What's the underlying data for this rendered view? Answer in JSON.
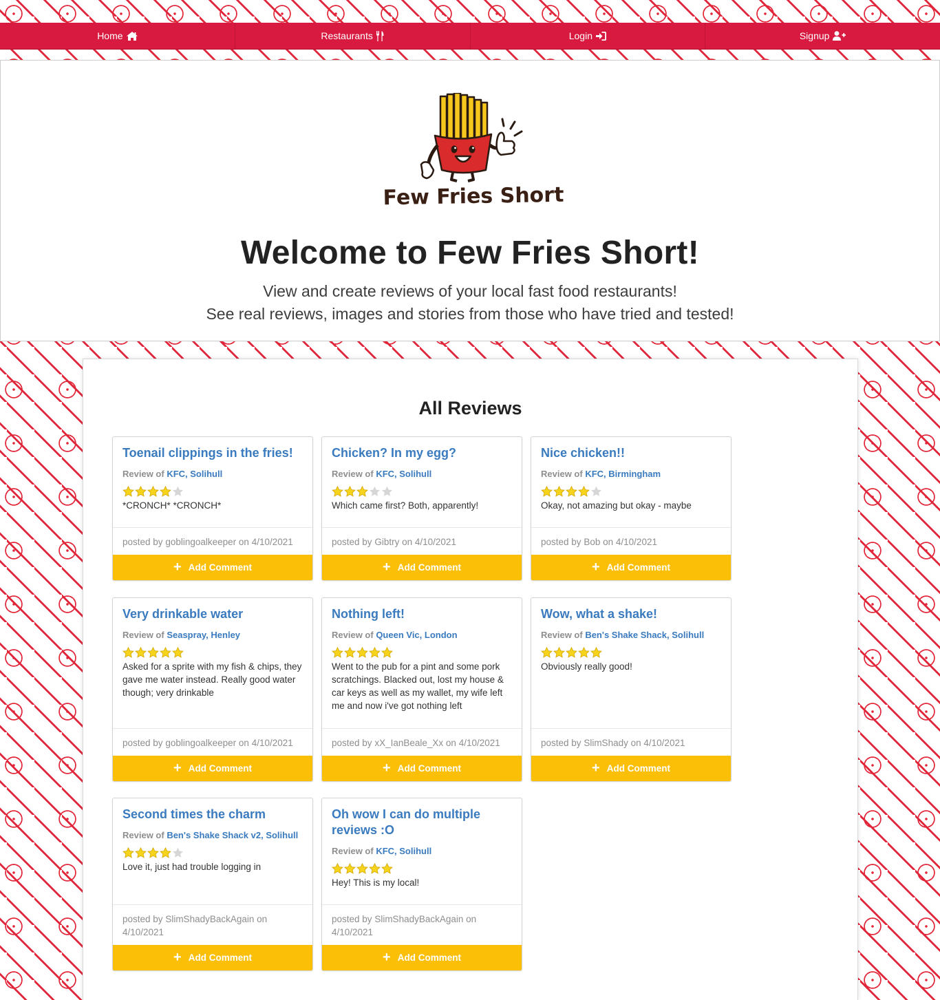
{
  "nav": {
    "items": [
      {
        "label": "Home",
        "icon": "home-icon"
      },
      {
        "label": "Restaurants",
        "icon": "utensils-icon"
      },
      {
        "label": "Login",
        "icon": "sign-in-icon"
      },
      {
        "label": "Signup",
        "icon": "user-plus-icon"
      }
    ]
  },
  "hero": {
    "logo_text": "Few Fries Short",
    "title": "Welcome to Few Fries Short!",
    "subtitle_line1": "View and create reviews of your local fast food restaurants!",
    "subtitle_line2": "See real reviews, images and stories from those who have tried and tested!"
  },
  "reviews_section": {
    "title": "All Reviews",
    "review_of_prefix": "Review of",
    "posted_by_prefix": "posted by",
    "posted_on_word": "on",
    "add_comment_label": "Add Comment",
    "cards": [
      {
        "title": "Toenail clippings in the fries!",
        "restaurant": "KFC, Solihull",
        "rating": 4,
        "text": "*CRONCH* *CRONCH*",
        "author": "goblingoalkeeper",
        "date": "4/10/2021"
      },
      {
        "title": "Chicken? In my egg?",
        "restaurant": "KFC, Solihull",
        "rating": 3,
        "text": "Which came first? Both, apparently!",
        "author": "Gibtry",
        "date": "4/10/2021"
      },
      {
        "title": "Nice chicken!!",
        "restaurant": "KFC, Birmingham",
        "rating": 4,
        "text": "Okay, not amazing but okay - maybe",
        "author": "Bob",
        "date": "4/10/2021"
      },
      {
        "title": "Very drinkable water",
        "restaurant": "Seaspray, Henley",
        "rating": 5,
        "text": "Asked for a sprite with my fish & chips, they gave me water instead. Really good water though; very drinkable",
        "author": "goblingoalkeeper",
        "date": "4/10/2021"
      },
      {
        "title": "Nothing left!",
        "restaurant": "Queen Vic, London",
        "rating": 5,
        "text": "Went to the pub for a pint and some pork scratchings. Blacked out, lost my house & car keys as well as my wallet, my wife left me and now i've got nothing left",
        "author": "xX_IanBeale_Xx",
        "date": "4/10/2021"
      },
      {
        "title": "Wow, what a shake!",
        "restaurant": "Ben's Shake Shack, Solihull",
        "rating": 5,
        "text": "Obviously really good!",
        "author": "SlimShady",
        "date": "4/10/2021"
      },
      {
        "title": "Second times the charm",
        "restaurant": "Ben's Shake Shack v2, Solihull",
        "rating": 4,
        "text": "Love it, just had trouble logging in",
        "author": "SlimShadyBackAgain",
        "date": "4/10/2021"
      },
      {
        "title": "Oh wow I can do multiple reviews :O",
        "restaurant": "KFC, Solihull",
        "rating": 5,
        "text": "Hey! This is my local!",
        "author": "SlimShadyBackAgain",
        "date": "4/10/2021"
      }
    ]
  },
  "colors": {
    "nav_bg": "#d81a40",
    "accent_blue": "#3a7bbf",
    "button_yellow": "#fbbf08",
    "star_filled": "#f7d41c",
    "star_empty": "#d6d6d6",
    "pattern_red": "#e2263a"
  }
}
